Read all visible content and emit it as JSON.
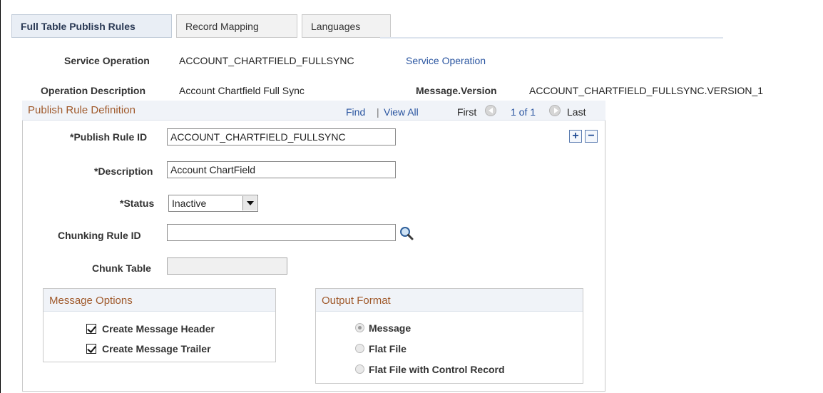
{
  "tabs": [
    {
      "label": "Full Table Publish Rules",
      "active": true
    },
    {
      "label": "Record Mapping",
      "active": false
    },
    {
      "label": "Languages",
      "active": false
    }
  ],
  "header": {
    "service_operation_label": "Service Operation",
    "service_operation_value": "ACCOUNT_CHARTFIELD_FULLSYNC",
    "service_operation_link": "Service Operation",
    "operation_description_label": "Operation Description",
    "operation_description_value": "Account Chartfield Full Sync",
    "message_version_label": "Message.Version",
    "message_version_value": "ACCOUNT_CHARTFIELD_FULLSYNC.VERSION_1"
  },
  "publish_rule": {
    "title": "Publish Rule Definition",
    "find": "Find",
    "separator": "|",
    "view_all": "View All",
    "first": "First",
    "count": "1 of 1",
    "last": "Last",
    "add_icon": "+",
    "remove_icon": "−",
    "publish_rule_id_label": "*Publish Rule ID",
    "publish_rule_id_value": "ACCOUNT_CHARTFIELD_FULLSYNC",
    "description_label": "*Description",
    "description_value": "Account ChartField",
    "status_label": "*Status",
    "status_value": "Inactive",
    "chunking_rule_label": "Chunking Rule ID",
    "chunking_rule_value": "",
    "chunk_table_label": "Chunk Table",
    "chunk_table_value": ""
  },
  "message_options": {
    "title": "Message Options",
    "items": [
      {
        "label": "Create Message Header",
        "checked": true
      },
      {
        "label": "Create Message Trailer",
        "checked": true
      }
    ]
  },
  "output_format": {
    "title": "Output Format",
    "options": [
      {
        "label": "Message",
        "selected": true
      },
      {
        "label": "Flat File",
        "selected": false
      },
      {
        "label": "Flat File with Control Record",
        "selected": false
      }
    ]
  },
  "colors": {
    "link": "#2a55a0",
    "section_title": "#a05a2c",
    "header_bg": "#f0f3f8"
  }
}
